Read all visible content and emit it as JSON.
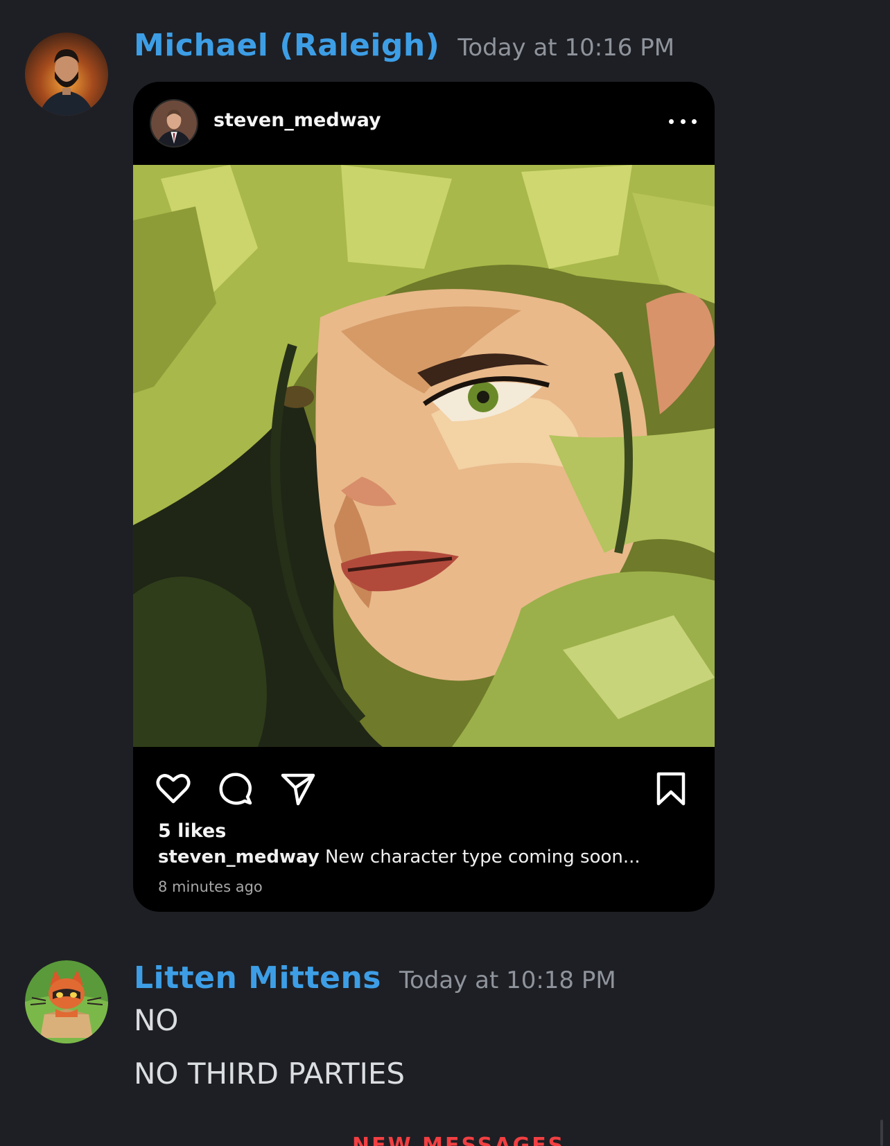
{
  "messages": [
    {
      "author": "Michael (Raleigh)",
      "timestamp": "Today at 10:16 PM",
      "avatar_icon": "bearded-man-avatar",
      "embed": {
        "platform": "instagram",
        "username": "steven_medway",
        "avatar_icon": "man-in-suit-avatar",
        "more_icon": "more-dots-icon",
        "image": "green-haired-elf-woman-illustration",
        "likes": "5 likes",
        "caption_user": "steven_medway",
        "caption_text": " New character type coming soon...",
        "time_ago": "8 minutes ago",
        "action_icons": [
          "heart-icon",
          "comment-icon",
          "share-icon",
          "bookmark-icon"
        ]
      }
    },
    {
      "author": "Litten Mittens",
      "timestamp": "Today at 10:18 PM",
      "avatar_icon": "litten-cat-avatar",
      "lines": [
        "NO",
        "NO THIRD PARTIES"
      ]
    }
  ],
  "divider": {
    "label": "NEW MESSAGES"
  },
  "colors": {
    "background": "#1e1f24",
    "username": "#3d9ee6",
    "timestamp": "#8f949c",
    "text": "#dbdee1",
    "embed_bg": "#000000",
    "new_divider": "#f23f42"
  }
}
